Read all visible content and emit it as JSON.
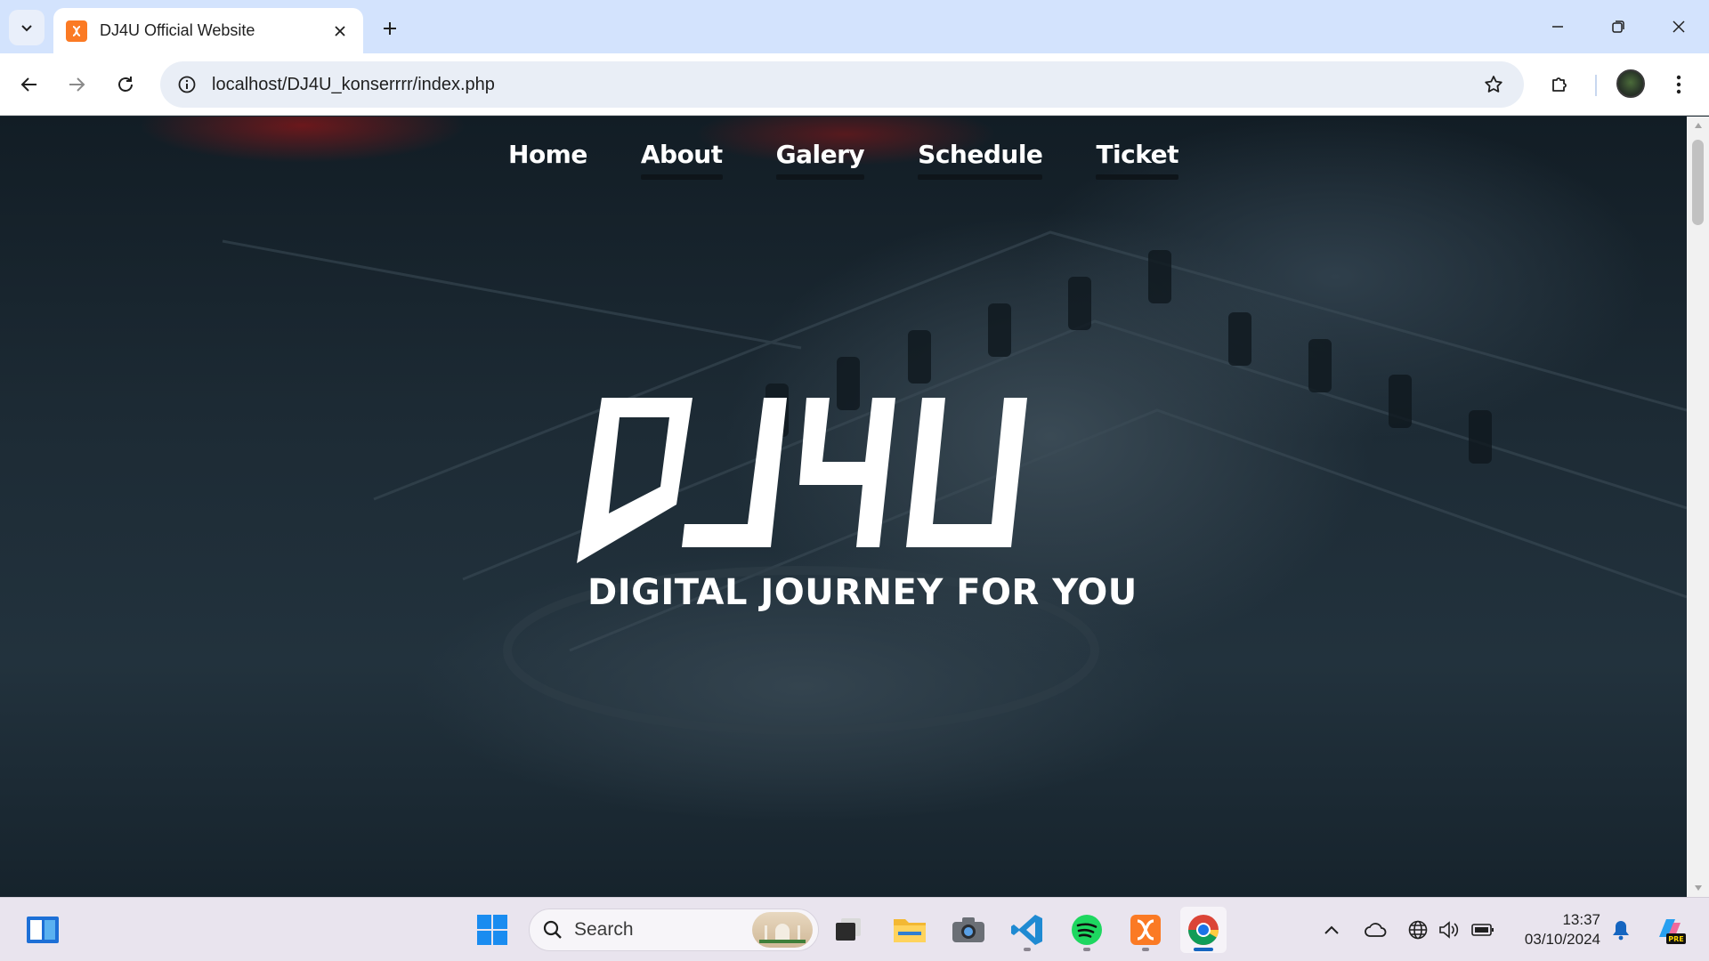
{
  "browser": {
    "tab_title": "DJ4U Official Website",
    "url": "localhost/DJ4U_konserrrr/index.php"
  },
  "site": {
    "nav": [
      "Home",
      "About",
      "Galery",
      "Schedule",
      "Ticket"
    ],
    "logo_text": "DJ4U",
    "tagline": "DIGITAL JOURNEY FOR YOU"
  },
  "taskbar": {
    "search_placeholder": "Search",
    "time": "13:37",
    "date": "03/10/2024",
    "copilot_badge": "PRE"
  },
  "colors": {
    "tab_strip": "#d3e3fd",
    "favicon": "#fb7a24",
    "hero_bg": "#1c2a34",
    "accent_blue": "#1565c0"
  }
}
